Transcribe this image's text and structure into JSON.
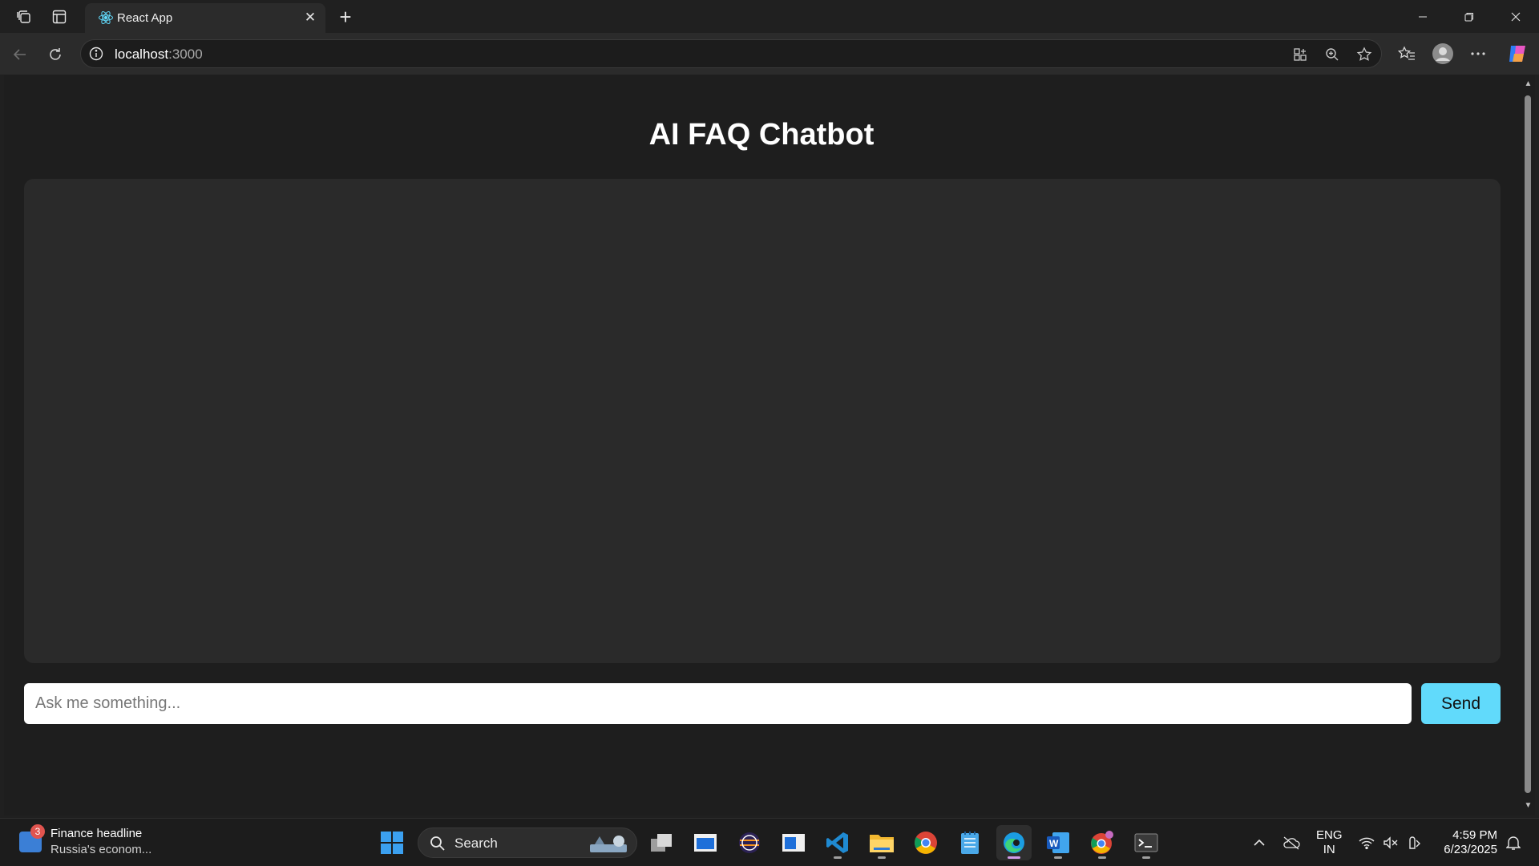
{
  "browser": {
    "tab_title": "React App",
    "url_host": "localhost",
    "url_port": ":3000"
  },
  "page": {
    "title": "AI FAQ Chatbot",
    "input_placeholder": "Ask me something...",
    "input_value": "",
    "send_label": "Send"
  },
  "taskbar": {
    "news_badge": "3",
    "news_title": "Finance headline",
    "news_subtitle": "Russia's econom...",
    "search_label": "Search",
    "lang_line1": "ENG",
    "lang_line2": "IN",
    "time": "4:59 PM",
    "date": "6/23/2025"
  },
  "colors": {
    "accent": "#61dafb",
    "page_bg": "#1e1e1e",
    "chat_bg": "#2a2a2a"
  }
}
